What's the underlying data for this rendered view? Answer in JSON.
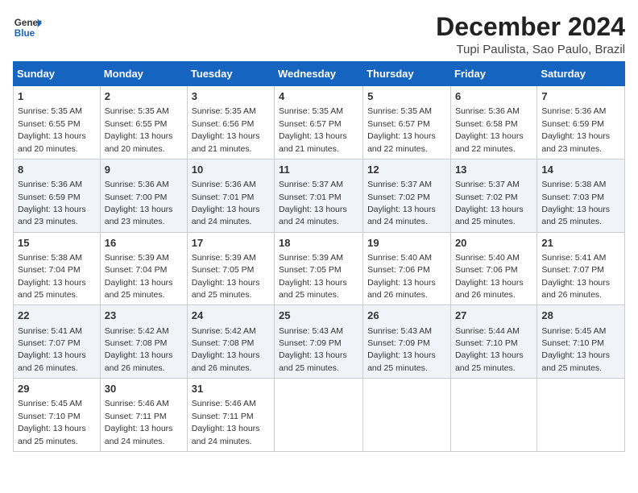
{
  "logo": {
    "line1": "General",
    "line2": "Blue"
  },
  "title": "December 2024",
  "location": "Tupi Paulista, Sao Paulo, Brazil",
  "days_of_week": [
    "Sunday",
    "Monday",
    "Tuesday",
    "Wednesday",
    "Thursday",
    "Friday",
    "Saturday"
  ],
  "weeks": [
    [
      {
        "day": 1,
        "info": "Sunrise: 5:35 AM\nSunset: 6:55 PM\nDaylight: 13 hours\nand 20 minutes."
      },
      {
        "day": 2,
        "info": "Sunrise: 5:35 AM\nSunset: 6:55 PM\nDaylight: 13 hours\nand 20 minutes."
      },
      {
        "day": 3,
        "info": "Sunrise: 5:35 AM\nSunset: 6:56 PM\nDaylight: 13 hours\nand 21 minutes."
      },
      {
        "day": 4,
        "info": "Sunrise: 5:35 AM\nSunset: 6:57 PM\nDaylight: 13 hours\nand 21 minutes."
      },
      {
        "day": 5,
        "info": "Sunrise: 5:35 AM\nSunset: 6:57 PM\nDaylight: 13 hours\nand 22 minutes."
      },
      {
        "day": 6,
        "info": "Sunrise: 5:36 AM\nSunset: 6:58 PM\nDaylight: 13 hours\nand 22 minutes."
      },
      {
        "day": 7,
        "info": "Sunrise: 5:36 AM\nSunset: 6:59 PM\nDaylight: 13 hours\nand 23 minutes."
      }
    ],
    [
      {
        "day": 8,
        "info": "Sunrise: 5:36 AM\nSunset: 6:59 PM\nDaylight: 13 hours\nand 23 minutes."
      },
      {
        "day": 9,
        "info": "Sunrise: 5:36 AM\nSunset: 7:00 PM\nDaylight: 13 hours\nand 23 minutes."
      },
      {
        "day": 10,
        "info": "Sunrise: 5:36 AM\nSunset: 7:01 PM\nDaylight: 13 hours\nand 24 minutes."
      },
      {
        "day": 11,
        "info": "Sunrise: 5:37 AM\nSunset: 7:01 PM\nDaylight: 13 hours\nand 24 minutes."
      },
      {
        "day": 12,
        "info": "Sunrise: 5:37 AM\nSunset: 7:02 PM\nDaylight: 13 hours\nand 24 minutes."
      },
      {
        "day": 13,
        "info": "Sunrise: 5:37 AM\nSunset: 7:02 PM\nDaylight: 13 hours\nand 25 minutes."
      },
      {
        "day": 14,
        "info": "Sunrise: 5:38 AM\nSunset: 7:03 PM\nDaylight: 13 hours\nand 25 minutes."
      }
    ],
    [
      {
        "day": 15,
        "info": "Sunrise: 5:38 AM\nSunset: 7:04 PM\nDaylight: 13 hours\nand 25 minutes."
      },
      {
        "day": 16,
        "info": "Sunrise: 5:39 AM\nSunset: 7:04 PM\nDaylight: 13 hours\nand 25 minutes."
      },
      {
        "day": 17,
        "info": "Sunrise: 5:39 AM\nSunset: 7:05 PM\nDaylight: 13 hours\nand 25 minutes."
      },
      {
        "day": 18,
        "info": "Sunrise: 5:39 AM\nSunset: 7:05 PM\nDaylight: 13 hours\nand 25 minutes."
      },
      {
        "day": 19,
        "info": "Sunrise: 5:40 AM\nSunset: 7:06 PM\nDaylight: 13 hours\nand 26 minutes."
      },
      {
        "day": 20,
        "info": "Sunrise: 5:40 AM\nSunset: 7:06 PM\nDaylight: 13 hours\nand 26 minutes."
      },
      {
        "day": 21,
        "info": "Sunrise: 5:41 AM\nSunset: 7:07 PM\nDaylight: 13 hours\nand 26 minutes."
      }
    ],
    [
      {
        "day": 22,
        "info": "Sunrise: 5:41 AM\nSunset: 7:07 PM\nDaylight: 13 hours\nand 26 minutes."
      },
      {
        "day": 23,
        "info": "Sunrise: 5:42 AM\nSunset: 7:08 PM\nDaylight: 13 hours\nand 26 minutes."
      },
      {
        "day": 24,
        "info": "Sunrise: 5:42 AM\nSunset: 7:08 PM\nDaylight: 13 hours\nand 26 minutes."
      },
      {
        "day": 25,
        "info": "Sunrise: 5:43 AM\nSunset: 7:09 PM\nDaylight: 13 hours\nand 25 minutes."
      },
      {
        "day": 26,
        "info": "Sunrise: 5:43 AM\nSunset: 7:09 PM\nDaylight: 13 hours\nand 25 minutes."
      },
      {
        "day": 27,
        "info": "Sunrise: 5:44 AM\nSunset: 7:10 PM\nDaylight: 13 hours\nand 25 minutes."
      },
      {
        "day": 28,
        "info": "Sunrise: 5:45 AM\nSunset: 7:10 PM\nDaylight: 13 hours\nand 25 minutes."
      }
    ],
    [
      {
        "day": 29,
        "info": "Sunrise: 5:45 AM\nSunset: 7:10 PM\nDaylight: 13 hours\nand 25 minutes."
      },
      {
        "day": 30,
        "info": "Sunrise: 5:46 AM\nSunset: 7:11 PM\nDaylight: 13 hours\nand 24 minutes."
      },
      {
        "day": 31,
        "info": "Sunrise: 5:46 AM\nSunset: 7:11 PM\nDaylight: 13 hours\nand 24 minutes."
      },
      null,
      null,
      null,
      null
    ]
  ]
}
